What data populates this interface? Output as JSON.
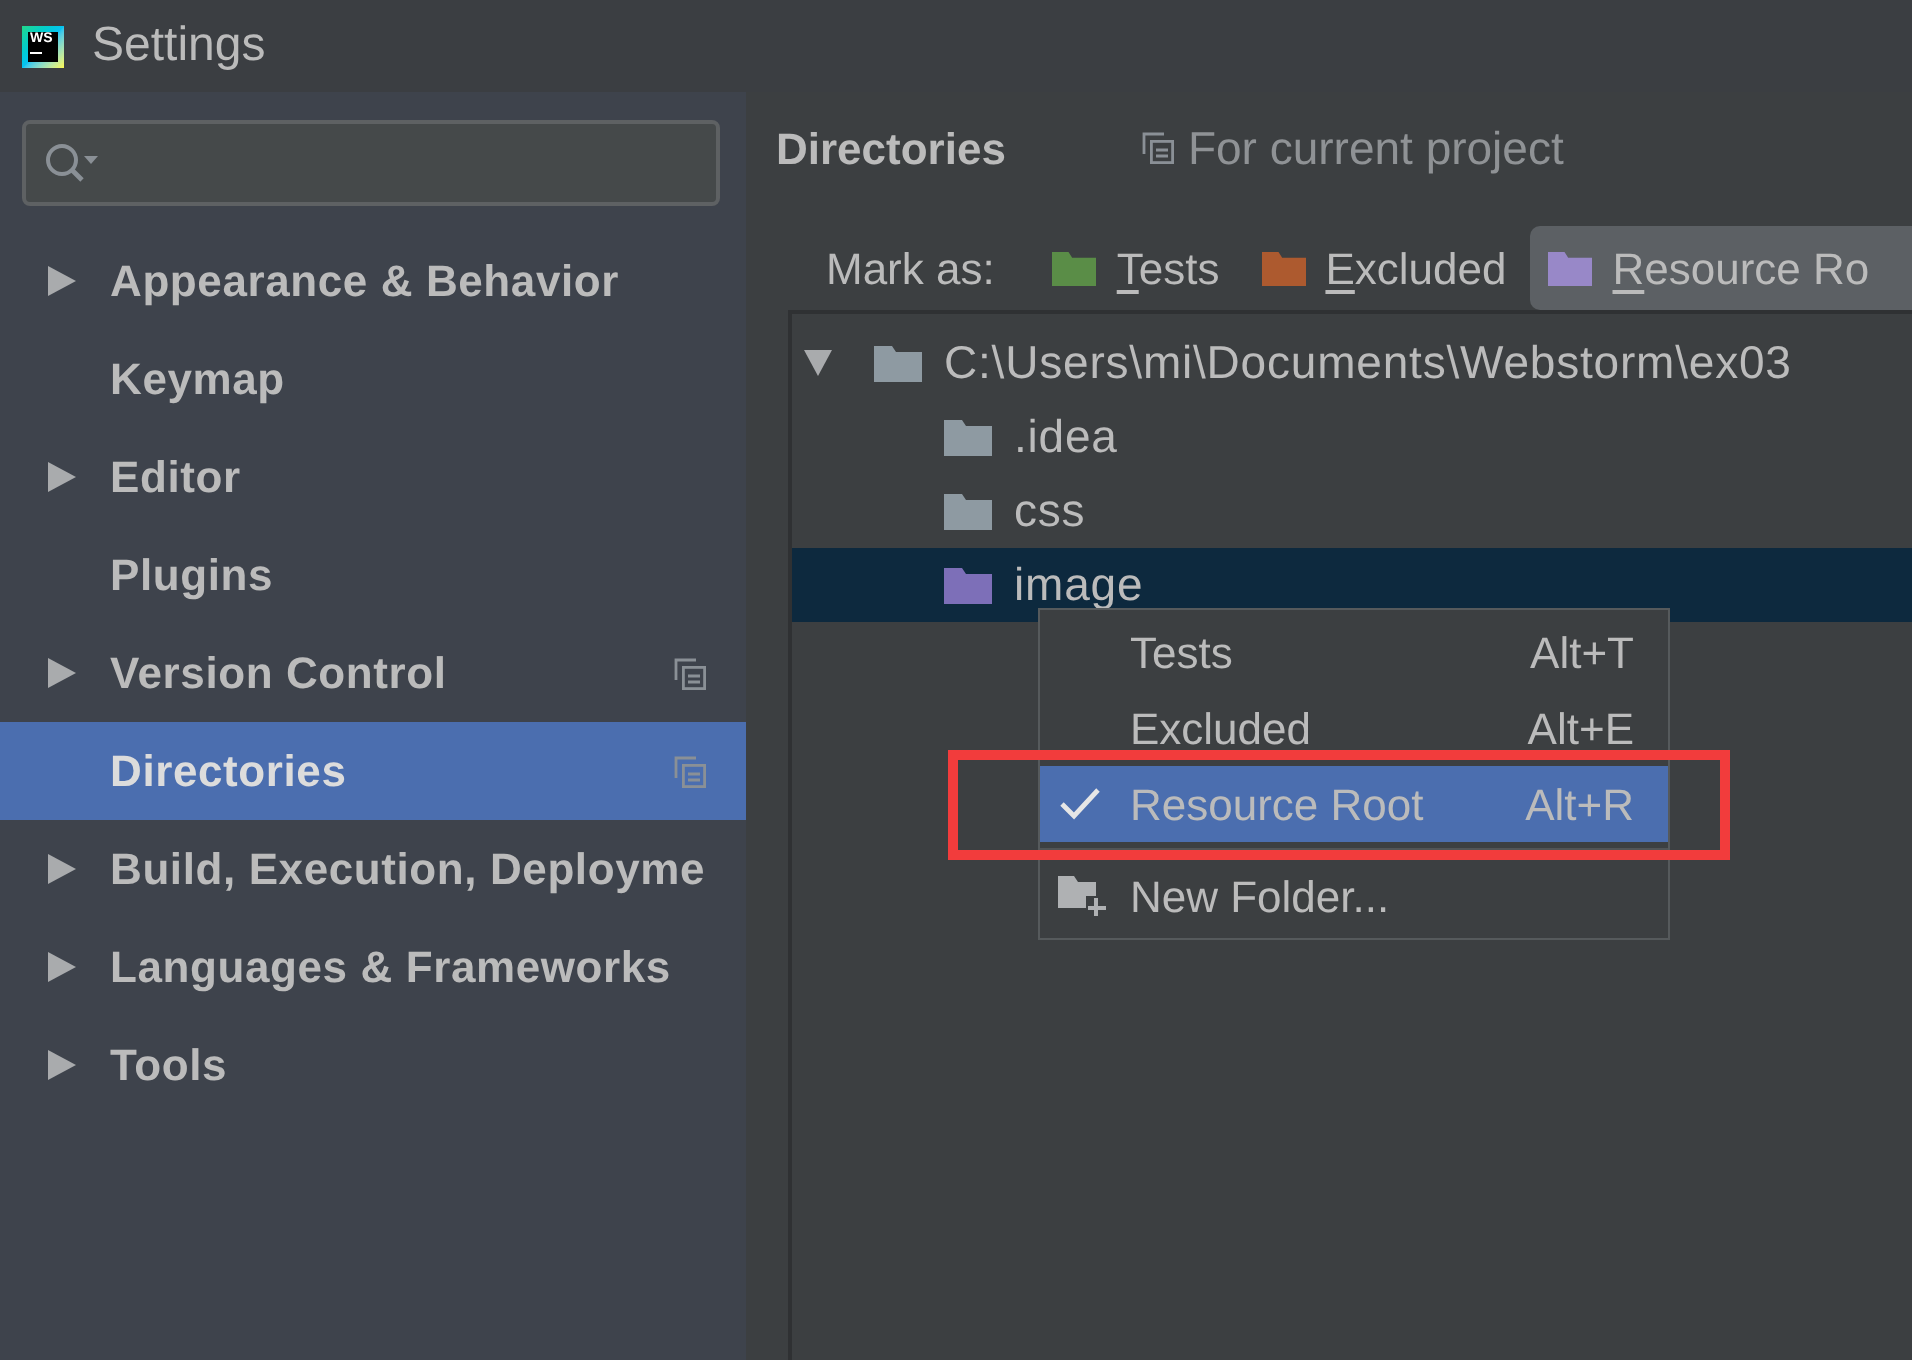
{
  "window": {
    "logo": "WS",
    "title": "Settings"
  },
  "sidebar": {
    "items": [
      {
        "label": "Appearance & Behavior",
        "expandable": true,
        "project_icon": false,
        "selected": false
      },
      {
        "label": "Keymap",
        "expandable": false,
        "project_icon": false,
        "selected": false
      },
      {
        "label": "Editor",
        "expandable": true,
        "project_icon": false,
        "selected": false
      },
      {
        "label": "Plugins",
        "expandable": false,
        "project_icon": false,
        "selected": false
      },
      {
        "label": "Version Control",
        "expandable": true,
        "project_icon": true,
        "selected": false
      },
      {
        "label": "Directories",
        "expandable": false,
        "project_icon": true,
        "selected": true
      },
      {
        "label": "Build, Execution, Deployme",
        "expandable": true,
        "project_icon": false,
        "selected": false
      },
      {
        "label": "Languages & Frameworks",
        "expandable": true,
        "project_icon": false,
        "selected": false
      },
      {
        "label": "Tools",
        "expandable": true,
        "project_icon": false,
        "selected": false
      }
    ]
  },
  "page": {
    "title": "Directories",
    "scope": "For current project"
  },
  "mark_as": {
    "label": "Mark as:",
    "buttons": [
      {
        "label": "Tests",
        "color": "#5a8d47",
        "selected": false
      },
      {
        "label": "Excluded",
        "color": "#ad5a2f",
        "selected": false
      },
      {
        "label": "Resource Ro",
        "color": "#9888c8",
        "selected": true
      }
    ]
  },
  "tree": {
    "root": {
      "label": "C:\\Users\\mi\\Documents\\Webstorm\\ex03",
      "expanded": true,
      "selected": false,
      "color": "#8e9aa2",
      "children": [
        {
          "label": ".idea",
          "color": "#8e9aa2",
          "selected": false
        },
        {
          "label": "css",
          "color": "#8e9aa2",
          "selected": false
        },
        {
          "label": "image",
          "color": "#7d6fb8",
          "selected": true
        }
      ]
    }
  },
  "context_menu": {
    "items": [
      {
        "kind": "option",
        "label": "Tests",
        "shortcut": "Alt+T",
        "checked": false,
        "selected": false
      },
      {
        "kind": "option",
        "label": "Excluded",
        "shortcut": "Alt+E",
        "checked": false,
        "selected": false
      },
      {
        "kind": "option",
        "label": "Resource Root",
        "shortcut": "Alt+R",
        "checked": true,
        "selected": true
      },
      {
        "kind": "separator"
      },
      {
        "kind": "action",
        "label": "New Folder..."
      }
    ]
  },
  "annotations": [
    {
      "kind": "rectangle"
    }
  ]
}
